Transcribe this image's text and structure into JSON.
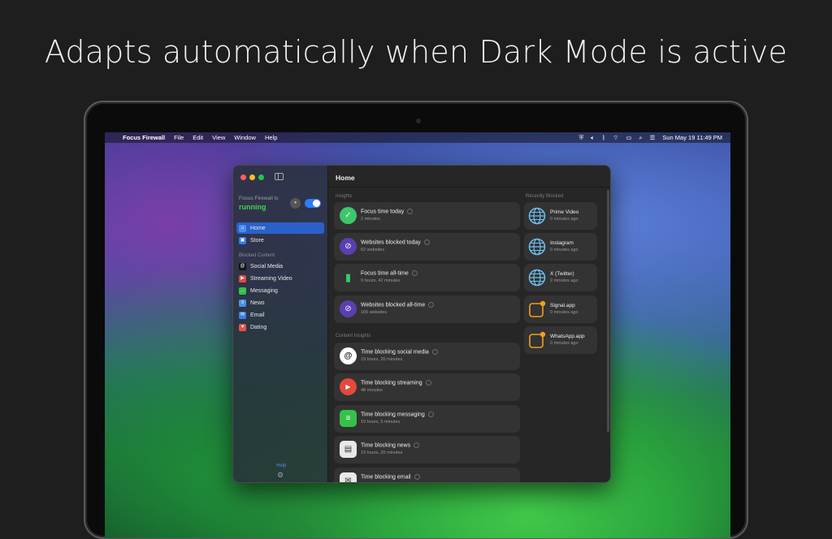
{
  "headline": "Adapts automatically when Dark Mode is active",
  "menubar": {
    "apple": "",
    "app_name": "Focus Firewall",
    "menus": [
      "File",
      "Edit",
      "View",
      "Window",
      "Help"
    ],
    "datetime": "Sun May 19  11:49 PM"
  },
  "sidebar": {
    "status_label": "Focus Firewall is",
    "status_value": "running",
    "pause_label": "⏸",
    "nav": [
      {
        "label": "Home",
        "color": "#2a61c9"
      },
      {
        "label": "Store",
        "color": "#2f7cf6"
      }
    ],
    "blocked_label": "Blocked Content",
    "blocked": [
      {
        "label": "Social Media",
        "color": "#111111",
        "glyph": "@"
      },
      {
        "label": "Streaming Video",
        "color": "#e24a3b",
        "glyph": "▶"
      },
      {
        "label": "Messaging",
        "color": "#35c14a",
        "glyph": "…"
      },
      {
        "label": "News",
        "color": "#4a8ff0",
        "glyph": "≡"
      },
      {
        "label": "Email",
        "color": "#3a7fe8",
        "glyph": "✉"
      },
      {
        "label": "Dating",
        "color": "#e85048",
        "glyph": "♥"
      }
    ],
    "help": "Help",
    "gear": "⚙"
  },
  "main": {
    "title": "Home",
    "insights_label": "Insights",
    "recently_label": "Recently Blocked",
    "content_label": "Content Insights",
    "insights": [
      {
        "title": "Focus time today",
        "sub": "2 minutes",
        "icon": "check-icon",
        "color": "#3cc86a",
        "glyph": "✓"
      },
      {
        "title": "Websites blocked today",
        "sub": "62 websites",
        "icon": "blocked-globe-icon",
        "color": "#5b3fb0",
        "glyph": "⊘"
      },
      {
        "title": "Focus time all-time",
        "sub": "9 hours, 42 minutes",
        "icon": "bars-icon",
        "color": "#2e8b3a",
        "glyph": "▮"
      },
      {
        "title": "Websites blocked all-time",
        "sub": "165 websites",
        "icon": "blocked-globe-icon",
        "color": "#5b3fb0",
        "glyph": "⊘"
      }
    ],
    "content": [
      {
        "title": "Time blocking social media",
        "sub": "19 hours, 20 minutes",
        "icon": "at-icon",
        "color": "#111111",
        "glyph": "@"
      },
      {
        "title": "Time blocking streaming",
        "sub": "48 minutes",
        "icon": "play-icon",
        "color": "#e24a3b",
        "glyph": "▶"
      },
      {
        "title": "Time blocking messaging",
        "sub": "10 hours, 5 minutes",
        "icon": "message-icon",
        "color": "#35c14a",
        "glyph": "≡"
      },
      {
        "title": "Time blocking news",
        "sub": "19 hours, 20 minutes",
        "icon": "newspaper-icon",
        "color": "#e8e8e8",
        "glyph": "▤"
      },
      {
        "title": "Time blocking email",
        "sub": "",
        "icon": "mail-icon",
        "color": "#e8e8e8",
        "glyph": "✉"
      }
    ],
    "recent": [
      {
        "title": "Prime Video",
        "sub": "0 minutes ago",
        "icon": "globe-icon"
      },
      {
        "title": "Instagram",
        "sub": "0 minutes ago",
        "icon": "globe-icon"
      },
      {
        "title": "X (Twitter)",
        "sub": "2 minutes ago",
        "icon": "globe-icon"
      },
      {
        "title": "Signal.app",
        "sub": "0 minutes ago",
        "icon": "app-icon"
      },
      {
        "title": "WhatsApp.app",
        "sub": "0 minutes ago",
        "icon": "app-icon"
      }
    ]
  }
}
